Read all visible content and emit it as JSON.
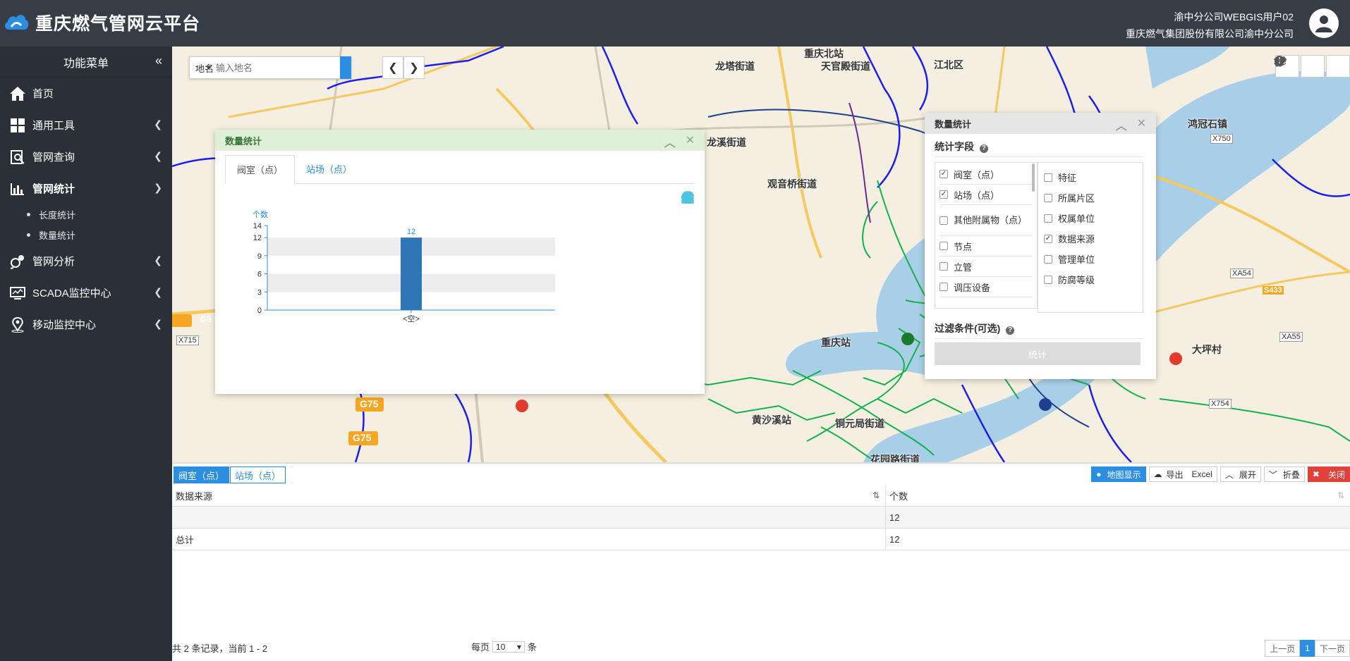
{
  "header": {
    "title": "重庆燃气管网云平台",
    "user_line1": "渝中分公司WEBGIS用户02",
    "user_line2": "重庆燃气集团股份有限公司渝中分公司",
    "bg_color": "#363d47"
  },
  "sidebar": {
    "title": "功能菜单",
    "items": [
      {
        "label": "首页",
        "icon": "home-icon"
      },
      {
        "label": "通用工具",
        "icon": "grid-icon"
      },
      {
        "label": "管网查询",
        "icon": "search-doc-icon"
      },
      {
        "label": "管网统计",
        "icon": "bar-chart-icon"
      },
      {
        "label": "管网分析",
        "icon": "analysis-icon"
      },
      {
        "label": "SCADA监控中心",
        "icon": "monitor-icon"
      },
      {
        "label": "移动监控中心",
        "icon": "location-icon"
      }
    ],
    "sub_items": [
      {
        "label": "长度统计"
      },
      {
        "label": "数量统计"
      }
    ]
  },
  "map": {
    "search_type": "地名",
    "search_placeholder": "输入地名",
    "labels": [
      "龙塔街道",
      "天官殿街道",
      "江北区",
      "鸿冠石镇",
      "龙溪街道",
      "观音桥街道",
      "重庆北站",
      "重庆站",
      "黄沙溪站",
      "铜元局街道",
      "大坪村",
      "花园路街道",
      "G75",
      "G75",
      "X715",
      "X750",
      "XA54",
      "XA55",
      "X754",
      "S433",
      "G5"
    ]
  },
  "stat_panel": {
    "title": "数量统计",
    "tabs": [
      "阀室（点）",
      "站场（点）"
    ]
  },
  "chart_data": {
    "type": "bar",
    "categories": [
      "<空>"
    ],
    "values": [
      12
    ],
    "title": "",
    "xlabel": "",
    "ylabel": "个数",
    "ylim": [
      0,
      14
    ],
    "yticks": [
      0,
      3,
      6,
      9,
      12,
      14
    ],
    "data_labels": [
      "12"
    ],
    "bar_color": "#2e75b6"
  },
  "field_panel": {
    "title": "数量统计",
    "section_fields": "统计字段",
    "left_fields": [
      {
        "label": "阀室（点）",
        "checked": true
      },
      {
        "label": "站场（点）",
        "checked": true
      },
      {
        "label": "其他附属物（点）",
        "checked": false
      },
      {
        "label": "节点",
        "checked": false
      },
      {
        "label": "立管",
        "checked": false
      },
      {
        "label": "调压设备",
        "checked": false
      }
    ],
    "right_fields": [
      {
        "label": "特征",
        "checked": false
      },
      {
        "label": "所属片区",
        "checked": false
      },
      {
        "label": "权属单位",
        "checked": false
      },
      {
        "label": "数据来源",
        "checked": true
      },
      {
        "label": "管理单位",
        "checked": false
      },
      {
        "label": "防腐等级",
        "checked": false
      }
    ],
    "section_filter": "过滤条件(可选)",
    "stat_button": "统计"
  },
  "bottom": {
    "tabs": [
      "阀室（点）",
      "站场（点）"
    ],
    "buttons": {
      "map_show": "地图显示",
      "export": "导出",
      "export_fmt": "Excel",
      "expand": "展开",
      "collapse": "折叠",
      "close": "关闭"
    },
    "columns": [
      "数据来源",
      "个数"
    ],
    "rows": [
      [
        "",
        "12"
      ],
      [
        "总计",
        "12"
      ]
    ],
    "footer": {
      "summary": "共 2 条记录，当前 1 - 2",
      "per_page_prefix": "每页",
      "per_page": "10",
      "per_page_suffix": "条",
      "prev": "上一页",
      "page": "1",
      "next": "下一页"
    }
  }
}
